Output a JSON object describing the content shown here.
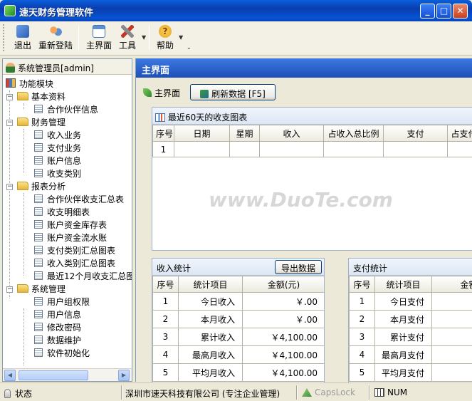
{
  "window": {
    "title": "速天财务管理软件",
    "minimize": "_",
    "maximize": "□",
    "close": "✕"
  },
  "toolbar": {
    "items": [
      {
        "label": "退出",
        "icon": "exit-door-icon",
        "color": "#2B5FB3"
      },
      {
        "label": "重新登陆",
        "icon": "users-relogin-icon",
        "color": "#E07A2E"
      },
      {
        "label": "主界面",
        "icon": "main-window-icon",
        "color": "#5B8FD0"
      },
      {
        "label": "工具",
        "icon": "tools-icon",
        "color": "#8A8A8A"
      },
      {
        "label": "帮助",
        "icon": "help-icon",
        "color": "#E8A21E"
      }
    ]
  },
  "sidebar": {
    "user": "系统管理员[admin]",
    "root": "功能模块",
    "groups": [
      {
        "label": "基本资料",
        "items": [
          "合作伙伴信息"
        ]
      },
      {
        "label": "财务管理",
        "items": [
          "收入业务",
          "支付业务",
          "账户信息",
          "收支类别"
        ]
      },
      {
        "label": "报表分析",
        "items": [
          "合作伙伴收支汇总表",
          "收支明细表",
          "账户资金库存表",
          "账户资金流水账",
          "支付类别汇总图表",
          "收入类别汇总图表",
          "最近12个月收支汇总图"
        ]
      },
      {
        "label": "系统管理",
        "items": [
          "用户组权限",
          "用户信息",
          "修改密码",
          "数据维护",
          "软件初始化"
        ]
      }
    ]
  },
  "main": {
    "header": "主界面",
    "breadcrumb": "主界面",
    "refresh_button": "刷新数据 [F5]",
    "chart_panel": {
      "title": "最近60天的收支图表",
      "columns": [
        "序号",
        "日期",
        "星期",
        "收入",
        "占收入总比例",
        "支付",
        "占支付"
      ],
      "rows": [
        [
          "1",
          "",
          "",
          "",
          "",
          "",
          ""
        ]
      ]
    },
    "income": {
      "title": "收入统计",
      "export_button": "导出数据",
      "columns": [
        "序号",
        "统计项目",
        "金额(元)"
      ],
      "rows": [
        [
          "1",
          "今日收入",
          "￥.00"
        ],
        [
          "2",
          "本月收入",
          "￥.00"
        ],
        [
          "3",
          "累计收入",
          "￥4,100.00"
        ],
        [
          "4",
          "最高月收入",
          "￥4,100.00"
        ],
        [
          "5",
          "平均月收入",
          "￥4,100.00"
        ]
      ]
    },
    "expense": {
      "title": "支付统计",
      "columns": [
        "序号",
        "统计项目",
        "金额"
      ],
      "rows": [
        [
          "1",
          "今日支付",
          ""
        ],
        [
          "2",
          "本月支付",
          ""
        ],
        [
          "3",
          "累计支付",
          ""
        ],
        [
          "4",
          "最高月支付",
          ""
        ],
        [
          "5",
          "平均月支付",
          ""
        ]
      ]
    }
  },
  "statusbar": {
    "status": "状态",
    "company": "深圳市速天科技有限公司 (专注企业管理)",
    "caps": "CapsLock",
    "num": "NUM"
  },
  "watermark": "www.DuoTe.com"
}
